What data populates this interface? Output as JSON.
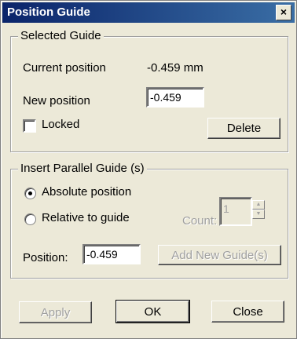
{
  "window": {
    "title": "Position Guide",
    "close_glyph": "×"
  },
  "selected_guide": {
    "legend": "Selected Guide",
    "current_label": "Current position",
    "current_value": "-0.459 mm",
    "new_label": "New position",
    "new_value": "-0.459",
    "locked_label": "Locked",
    "locked_checked": false,
    "delete_label": "Delete"
  },
  "insert_parallel": {
    "legend": "Insert Parallel Guide (s)",
    "absolute_label": "Absolute position",
    "relative_label": "Relative to guide",
    "selected_option": "absolute",
    "count_label": "Count:",
    "count_value": "1",
    "position_label": "Position:",
    "position_value": "-0.459",
    "add_label": "Add New Guide(s)"
  },
  "footer": {
    "apply_label": "Apply",
    "ok_label": "OK",
    "close_label": "Close"
  }
}
